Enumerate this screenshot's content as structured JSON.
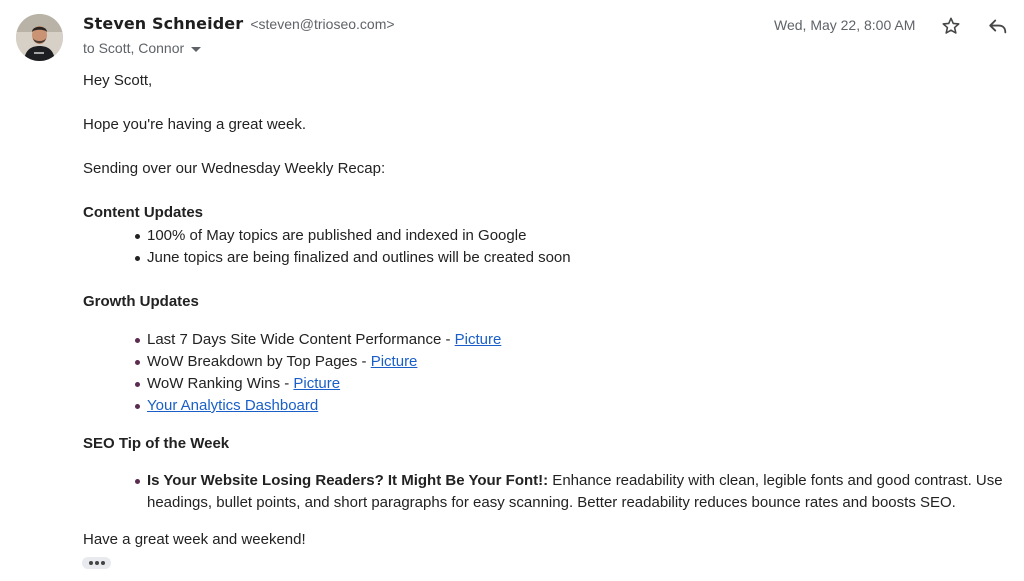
{
  "email": {
    "sender_name": "Steven Schneider",
    "sender_email": "<steven@trioseo.com>",
    "recipients": "to Scott, Connor",
    "timestamp": "Wed, May 22, 8:00 AM",
    "icons": {
      "star": "star-icon",
      "reply": "reply-icon",
      "caret": "chevron-down-icon",
      "more": "more-horiz-icon"
    }
  },
  "body": {
    "greeting": "Hey Scott,",
    "line1": "Hope you're having a great week.",
    "line2": "Sending over our Wednesday Weekly Recap:",
    "content_heading": "Content Updates",
    "content_items": [
      "100% of May topics are published and indexed in Google",
      "June topics are being finalized and outlines will be created soon"
    ],
    "growth_heading": "Growth Updates",
    "growth_items": [
      {
        "text": "Last 7 Days Site Wide Content Performance - ",
        "link": "Picture"
      },
      {
        "text": "WoW Breakdown by Top Pages - ",
        "link": "Picture"
      },
      {
        "text": "WoW Ranking Wins - ",
        "link": "Picture"
      },
      {
        "text": "",
        "link": "Your Analytics Dashboard"
      }
    ],
    "seo_heading": "SEO Tip of the Week",
    "seo_tip_title": "Is Your Website Losing Readers? It Might Be Your Font!:",
    "seo_tip_text": " Enhance readability with clean, legible fonts and good contrast. Use headings, bullet points, and short paragraphs for easy scanning. Better readability reduces bounce rates and boosts SEO.",
    "closing": "Have a great week and weekend!"
  },
  "colors": {
    "link": "#1a5fc8",
    "muted": "#5f6368",
    "text": "#222222"
  }
}
